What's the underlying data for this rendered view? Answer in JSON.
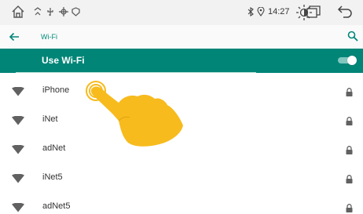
{
  "status_bar": {
    "icons": [
      "home-icon",
      "bluetooth-icon",
      "usb-icon",
      "settings-icon",
      "location-icon",
      "brightness-icon",
      "windows-icon",
      "back-arrow-icon"
    ],
    "time": "14:27"
  },
  "app_bar": {
    "title": "Wi-Fi",
    "back_icon": "arrow-left-icon",
    "search_icon": "search-icon"
  },
  "wifi_toggle": {
    "label": "Use Wi-Fi",
    "enabled": true
  },
  "networks": [
    {
      "name": "iPhone",
      "secured": true
    },
    {
      "name": "iNet",
      "secured": true
    },
    {
      "name": "adNet",
      "secured": true
    },
    {
      "name": "iNet5",
      "secured": true
    },
    {
      "name": "adNet5",
      "secured": true
    }
  ],
  "colors": {
    "accent": "#008577",
    "title": "#008a7a",
    "hand": "#f7bb1e"
  }
}
